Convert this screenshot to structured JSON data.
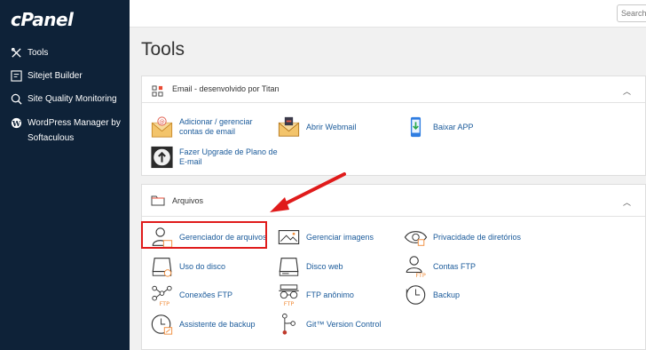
{
  "brand": {
    "logo": "cPanel"
  },
  "sidebar": {
    "items": [
      {
        "label": "Tools",
        "icon": "tools-icon"
      },
      {
        "label": "Sitejet Builder",
        "icon": "sitejet-icon"
      },
      {
        "label": "Site Quality Monitoring",
        "icon": "magnifier-icon"
      },
      {
        "label": "WordPress Manager by Softaculous",
        "icon": "wordpress-icon"
      }
    ]
  },
  "search": {
    "placeholder": "Search"
  },
  "page": {
    "title": "Tools"
  },
  "email_panel": {
    "title": "Email - desenvolvido por Titan",
    "tools": [
      {
        "label": "Adicionar / gerenciar contas de email",
        "icon": "email-envelope-icon"
      },
      {
        "label": "Abrir Webmail",
        "icon": "webmail-icon"
      },
      {
        "label": "Baixar APP",
        "icon": "phone-download-icon"
      },
      {
        "label": "Fazer Upgrade de Plano de E-mail",
        "icon": "upgrade-icon"
      }
    ]
  },
  "files_panel": {
    "title": "Arquivos",
    "tools": [
      {
        "label": "Gerenciador de arquivos",
        "icon": "file-manager-icon"
      },
      {
        "label": "Gerenciar imagens",
        "icon": "images-icon"
      },
      {
        "label": "Privacidade de diretórios",
        "icon": "eye-icon"
      },
      {
        "label": "Uso do disco",
        "icon": "disk-usage-icon"
      },
      {
        "label": "Disco web",
        "icon": "web-disk-icon"
      },
      {
        "label": "Contas FTP",
        "icon": "ftp-accounts-icon"
      },
      {
        "label": "Conexões FTP",
        "icon": "ftp-connections-icon"
      },
      {
        "label": "FTP anônimo",
        "icon": "anonymous-ftp-icon"
      },
      {
        "label": "Backup",
        "icon": "backup-icon"
      },
      {
        "label": "Assistente de backup",
        "icon": "backup-wizard-icon"
      },
      {
        "label": "Git™ Version Control",
        "icon": "git-icon"
      }
    ]
  },
  "colors": {
    "sidebar": "#0e2238",
    "link": "#1a5a9a",
    "accent_orange": "#f08c3a",
    "highlight_red": "#e01b1b"
  }
}
